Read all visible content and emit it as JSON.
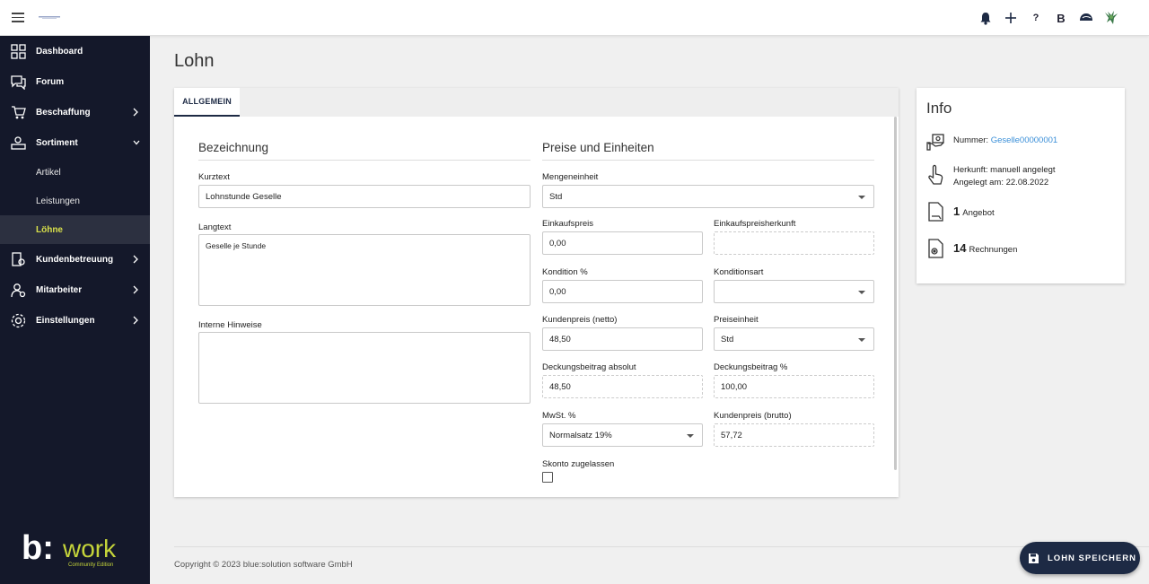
{
  "header": {
    "icons": [
      "menu-icon",
      "bell-icon",
      "plus-icon",
      "help-icon",
      "b-icon",
      "hat-icon",
      "user-avatar-icon"
    ],
    "help_glyph": "?",
    "b_glyph": "B"
  },
  "sidebar": {
    "items": [
      {
        "label": "Dashboard",
        "icon": "dashboard-icon"
      },
      {
        "label": "Forum",
        "icon": "forum-icon"
      },
      {
        "label": "Beschaffung",
        "icon": "cart-icon"
      },
      {
        "label": "Sortiment",
        "icon": "assortment-icon"
      },
      {
        "label": "Kundenbetreuung",
        "icon": "customer-icon"
      },
      {
        "label": "Mitarbeiter",
        "icon": "employee-icon"
      },
      {
        "label": "Einstellungen",
        "icon": "settings-icon"
      }
    ],
    "subitems": [
      {
        "label": "Artikel"
      },
      {
        "label": "Leistungen"
      },
      {
        "label": "Löhne"
      }
    ],
    "brand": {
      "primary": "b:",
      "secondary": "work",
      "tagline": "Community Edition"
    }
  },
  "page": {
    "title": "Lohn"
  },
  "tabs": [
    {
      "label": "ALLGEMEIN"
    }
  ],
  "form": {
    "bezeichnung": {
      "title": "Bezeichnung",
      "kurztext_label": "Kurztext",
      "kurztext_value": "Lohnstunde Geselle",
      "langtext_label": "Langtext",
      "langtext_value": "Geselle je Stunde",
      "hinweise_label": "Interne Hinweise",
      "hinweise_value": ""
    },
    "preise": {
      "title": "Preise und Einheiten",
      "mengeneinheit_label": "Mengeneinheit",
      "mengeneinheit_value": "Std",
      "einkaufspreis_label": "Einkaufspreis",
      "einkaufspreis_value": "0,00",
      "einkaufspreisherkunft_label": "Einkaufspreisherkunft",
      "einkaufspreisherkunft_value": "",
      "kondition_label": "Kondition %",
      "kondition_value": "0,00",
      "konditionsart_label": "Konditionsart",
      "konditionsart_value": "",
      "kundenpreis_netto_label": "Kundenpreis (netto)",
      "kundenpreis_netto_value": "48,50",
      "preiseinheit_label": "Preiseinheit",
      "preiseinheit_value": "Std",
      "db_absolut_label": "Deckungsbeitrag absolut",
      "db_absolut_value": "48,50",
      "db_prozent_label": "Deckungsbeitrag %",
      "db_prozent_value": "100,00",
      "mwst_label": "MwSt. %",
      "mwst_value": "Normalsatz 19%",
      "kundenpreis_brutto_label": "Kundenpreis (brutto)",
      "kundenpreis_brutto_value": "57,72",
      "skonto_label": "Skonto zugelassen",
      "skonto_checked": false
    }
  },
  "info": {
    "title": "Info",
    "nummer_label": "Nummer:",
    "nummer_value": "Geselle00000001",
    "herkunft": "Herkunft: manuell angelegt",
    "angelegt": "Angelegt am: 22.08.2022",
    "angebot_count": "1",
    "angebot_label": "Angebot",
    "rechnungen_count": "14",
    "rechnungen_label": "Rechnungen"
  },
  "footer": {
    "copyright": "Copyright © 2023 blue:solution software GmbH"
  },
  "actions": {
    "save_label": "LOHN SPEICHERN"
  },
  "colors": {
    "sidebar_bg": "#14182a",
    "active_text": "#d8e04a",
    "primary": "#1d2a44",
    "link": "#3a8fd8"
  }
}
